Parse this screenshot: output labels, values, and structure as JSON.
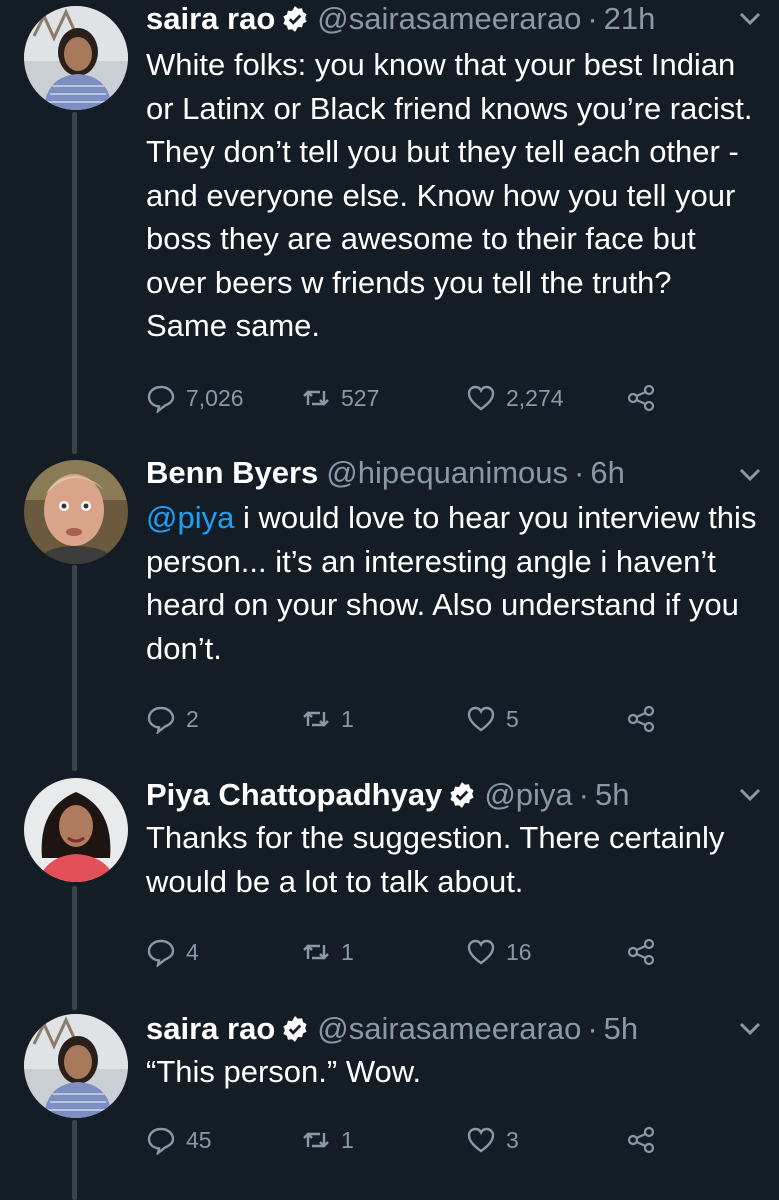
{
  "tweets": [
    {
      "name": "saira rao",
      "verified": true,
      "handle": "@sairasameerarao",
      "sep": "·",
      "time": "21h",
      "text": "White folks: you know that your best Indian or Latinx or Black friend knows you’re racist. They don’t tell you but they tell each other - and everyone else. Know how you tell your boss they are awesome to their face but over beers w friends you tell the truth? Same same.",
      "replies": "7,026",
      "retweets": "527",
      "likes": "2,274"
    },
    {
      "name": "Benn Byers",
      "verified": false,
      "handle": "@hipequanimous",
      "sep": "·",
      "time": "6h",
      "mention": "@piya",
      "text": " i would love to hear you interview this person... it’s an interesting angle i haven’t heard on your show. Also understand if you don’t.",
      "replies": "2",
      "retweets": "1",
      "likes": "5"
    },
    {
      "name": "Piya Chattopadhyay",
      "verified": true,
      "handle": "@piya",
      "sep": "·",
      "time": "5h",
      "text": "Thanks for the suggestion. There certainly would be a lot to talk about.",
      "replies": "4",
      "retweets": "1",
      "likes": "16"
    },
    {
      "name": "saira rao",
      "verified": true,
      "handle": "@sairasameerarao",
      "sep": "·",
      "time": "5h",
      "text": "“This person.” Wow.",
      "replies": "45",
      "retweets": "1",
      "likes": "3"
    }
  ],
  "icons": {
    "reply": "reply-icon",
    "retweet": "retweet-icon",
    "like": "heart-icon",
    "share": "share-icon",
    "menu": "chevron-down-icon",
    "verified": "verified-badge-icon"
  },
  "colors": {
    "background": "#141d26",
    "muted": "#8899a6",
    "link": "#1da1f2",
    "thread_line": "#38444d"
  }
}
